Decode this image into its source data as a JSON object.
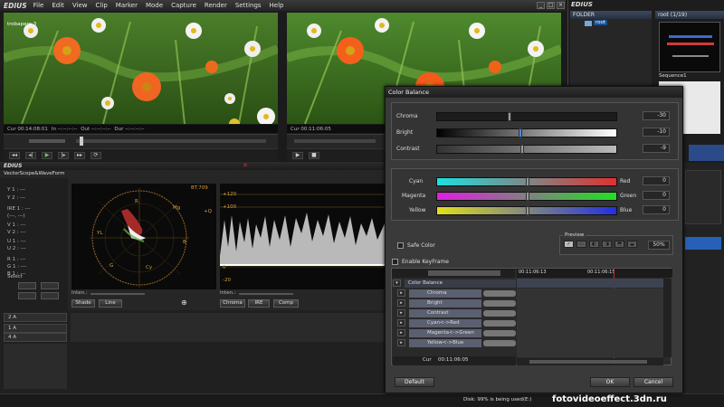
{
  "app": {
    "logo": "EDIUS",
    "menu": [
      "File",
      "Edit",
      "View",
      "Clip",
      "Marker",
      "Mode",
      "Capture",
      "Render",
      "Settings",
      "Help"
    ]
  },
  "player": {
    "clip_name": "trobapera 3",
    "cur": "Cur 00:14:08:01",
    "in": "In --:--:--:--",
    "out": "Out --:--:--:--",
    "dur": "Dur --:--:--:--"
  },
  "recorder": {
    "cur": "Cur 00:11:06:05",
    "in": "In --:--:--:--",
    "out": "Out --:--:--:--",
    "dur": "Dur 00:"
  },
  "folder_panel": {
    "logo": "EDIUS",
    "folder_header": "FOLDER",
    "folder_root": "root",
    "bin_header": "root (1/19)",
    "sequence_label": "Sequence1"
  },
  "scope": {
    "title": "VectorScope&WaveForm",
    "vector_label": "BT.709",
    "vector_marks": [
      "R",
      "Mg",
      "YL",
      "B",
      "G",
      "Cy"
    ],
    "iq_labels": [
      "+Q",
      "-I",
      "+I",
      "-Q"
    ],
    "wave_ticks": [
      "+120",
      "+100",
      "0",
      "-20"
    ],
    "readouts": {
      "y1": "Y 1 : ---",
      "y2": "Y 2 : ---",
      "ire": "IRE 1 : ---",
      "ire_sub": "(---, ---)",
      "v1": "V 1 : ---",
      "v2": "V 2 : ---",
      "u1": "U 1 : ---",
      "u2": "U 2 : ---",
      "r": "R 1 : ---",
      "g": "G 1 : ---",
      "b": "B 1 : ---"
    },
    "select_label": "Select",
    "inten_label": "Inten.:",
    "buttons_left": [
      "Shade",
      "Line"
    ],
    "buttons_right": [
      "Chroma",
      "IRE",
      "Comp"
    ]
  },
  "tracks": [
    {
      "name": "2 A"
    },
    {
      "name": "1 A"
    },
    {
      "name": "4 A"
    }
  ],
  "dialog": {
    "title": "Color Balance",
    "sliders": [
      {
        "label": "Chroma",
        "value": "-30",
        "pos": 0.4
      },
      {
        "label": "Bright",
        "value": "-10",
        "pos": 0.45
      },
      {
        "label": "Contrast",
        "value": "-9",
        "pos": 0.46
      }
    ],
    "color_sliders": [
      {
        "left": "Cyan",
        "right": "Red",
        "value": "0",
        "pos": 0.5
      },
      {
        "left": "Magenta",
        "right": "Green",
        "value": "0",
        "pos": 0.5
      },
      {
        "left": "Yellow",
        "right": "Blue",
        "value": "0",
        "pos": 0.5
      }
    ],
    "safe_color": "Safe Color",
    "preview_label": "Preview",
    "preview_percent": "50%",
    "enable_keyframe": "Enable KeyFrame",
    "timeline_times": [
      "00:11:06:13",
      "00:11:06:15"
    ],
    "keyframe_tree": [
      "Color Balance",
      "Chroma",
      "Bright",
      "Contrast",
      "Cyan<->Red",
      "Magenta<->Green",
      "Yellow<->Blue"
    ],
    "cur_label": "Cur",
    "cur_value": "00:11:06:05",
    "buttons": {
      "default": "Default",
      "ok": "OK",
      "cancel": "Cancel"
    }
  },
  "status": {
    "disk": "Disk: 99% is being used(E:)"
  },
  "watermark": "fotovideoeffect.3dn.ru"
}
